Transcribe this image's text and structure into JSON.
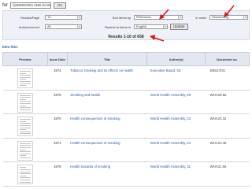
{
  "search": {
    "for_label": "for",
    "query_value": "((SMOKING) AND (CANC",
    "go_label": "Go"
  },
  "filters": {
    "results_per_page_label": "Results/Page",
    "results_per_page_value": "10",
    "authors_record_label": "Authors/record",
    "authors_record_value": "All",
    "sort_label": "Sort items by",
    "sort_value": "Relevance",
    "order_label": "in order",
    "order_value": "Descending",
    "language_label": "Restrict to items in",
    "language_value": "English",
    "update_label": "Update"
  },
  "results_count": "Results 1-10 of 658",
  "item_titles_label": "Item hits:",
  "table": {
    "headers": [
      "Preview",
      "Issue Date",
      "Title",
      "Author(s)",
      "Document no."
    ],
    "rows": [
      {
        "date": "1974",
        "title": "Tobacco smoking and its effects on health",
        "author": "Executive Board, 53",
        "doc": "EB53.R31"
      },
      {
        "date": "1976",
        "title": "Smoking and health",
        "author": "World Health Assembly, 29",
        "doc": "WHA29.55"
      },
      {
        "date": "1970",
        "title": "Health consequences of smoking",
        "author": "World Health Assembly, 23",
        "doc": "WHA23.32"
      },
      {
        "date": "1971",
        "title": "Health consequences of smoking",
        "author": "World Health Assembly, 24",
        "doc": "WHA24.48"
      },
      {
        "date": "1978",
        "title": "Health hazards of smoking",
        "author": "World Health Assembly, 31",
        "doc": "WHA31.56"
      }
    ]
  },
  "colors": {
    "link": "#245aa6",
    "arrow": "#d81b1b",
    "filter_bg": "#eef1f8",
    "header_bg": "#e2e7f1"
  }
}
